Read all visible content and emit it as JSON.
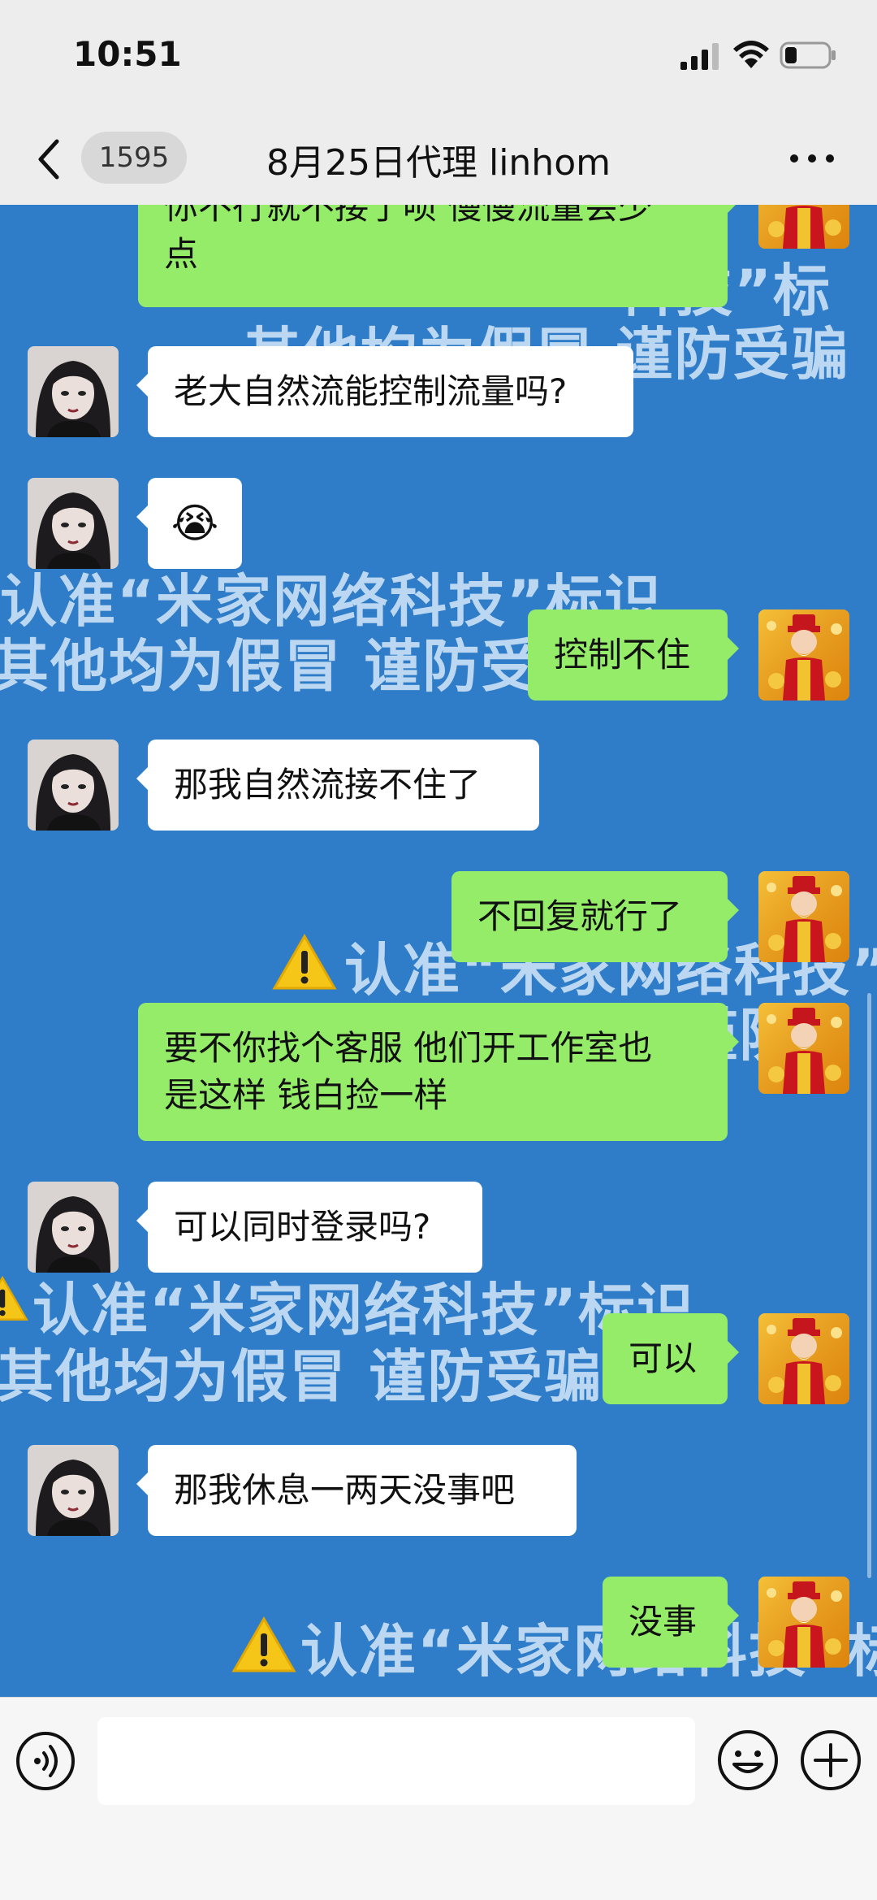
{
  "status_bar": {
    "time": "10:51"
  },
  "nav": {
    "unread_count": "1595",
    "title": "8月25日代理 linhom"
  },
  "watermarks": [
    "你不行就不接了呗 慢慢流量会少",
    "科技”标",
    "其他均为假冒 谨防受骗",
    "认准“米家网络科技”标识",
    "其他均为假冒 谨防受骗",
    "认准“米家网络科技”",
    "其他均为假冒 谨防",
    "认准“米家网络科技”标识",
    "其他均为假冒 谨防受骗",
    "认准“米家网络科技”标"
  ],
  "messages": [
    {
      "side": "right",
      "lines": [
        "你不行就不接了呗 慢慢流量会少",
        "点"
      ]
    },
    {
      "side": "left",
      "lines": [
        "老大自然流能控制流量吗?"
      ]
    },
    {
      "side": "left",
      "emoji": "😭"
    },
    {
      "side": "right",
      "lines": [
        "控制不住"
      ]
    },
    {
      "side": "left",
      "lines": [
        "那我自然流接不住了"
      ]
    },
    {
      "side": "right",
      "lines": [
        "不回复就行了"
      ]
    },
    {
      "side": "right",
      "lines": [
        "要不你找个客服 他们开工作室也",
        "是这样 钱白捡一样"
      ]
    },
    {
      "side": "left",
      "lines": [
        "可以同时登录吗?"
      ]
    },
    {
      "side": "right",
      "lines": [
        "可以"
      ]
    },
    {
      "side": "left",
      "lines": [
        "那我休息一两天没事吧"
      ]
    },
    {
      "side": "right",
      "lines": [
        "没事"
      ]
    }
  ],
  "input": {
    "placeholder": ""
  },
  "icons": {
    "back": "chevron-left-icon",
    "more": "more-dots-icon",
    "voice": "voice-icon",
    "emoji": "emoji-icon",
    "plus": "plus-icon"
  },
  "colors": {
    "chat_background": "#2f7dc8",
    "sent_bubble": "#95ec69",
    "received_bubble": "#ffffff",
    "bar_background": "#ededed"
  }
}
